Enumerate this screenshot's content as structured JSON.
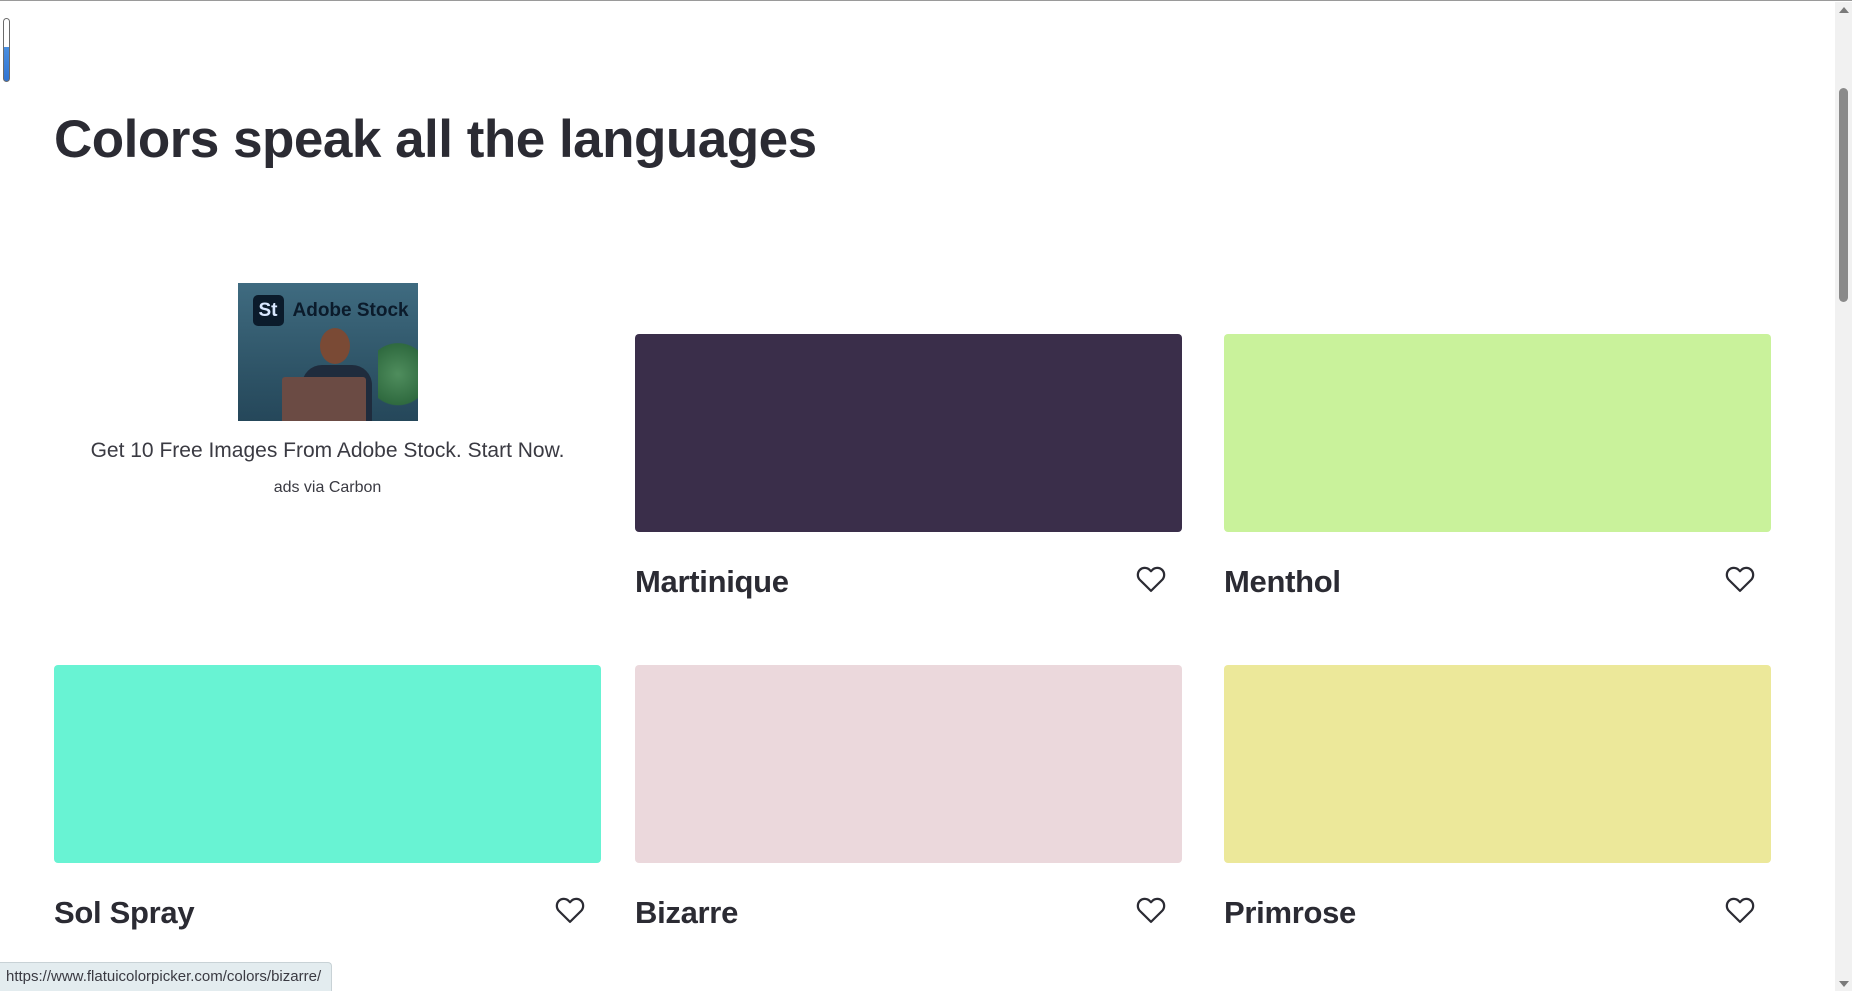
{
  "page": {
    "title": "Colors speak all the languages"
  },
  "ad": {
    "logo_mark": "St",
    "logo_text": "Adobe Stock",
    "text": "Get 10 Free Images From Adobe Stock. Start Now.",
    "via": "ads via Carbon"
  },
  "colors": [
    {
      "name": "Martinique",
      "hex": "#3a2e4a"
    },
    {
      "name": "Menthol",
      "hex": "#c9f29b"
    },
    {
      "name": "Sol Spray",
      "hex": "#68f3d3"
    },
    {
      "name": "Bizarre",
      "hex": "#ebd8dc"
    },
    {
      "name": "Primrose",
      "hex": "#ece89a"
    }
  ],
  "status_bar": {
    "url": "https://www.flatuicolorpicker.com/colors/bizarre/"
  },
  "icons": {
    "favorite": "heart-outline-icon"
  }
}
